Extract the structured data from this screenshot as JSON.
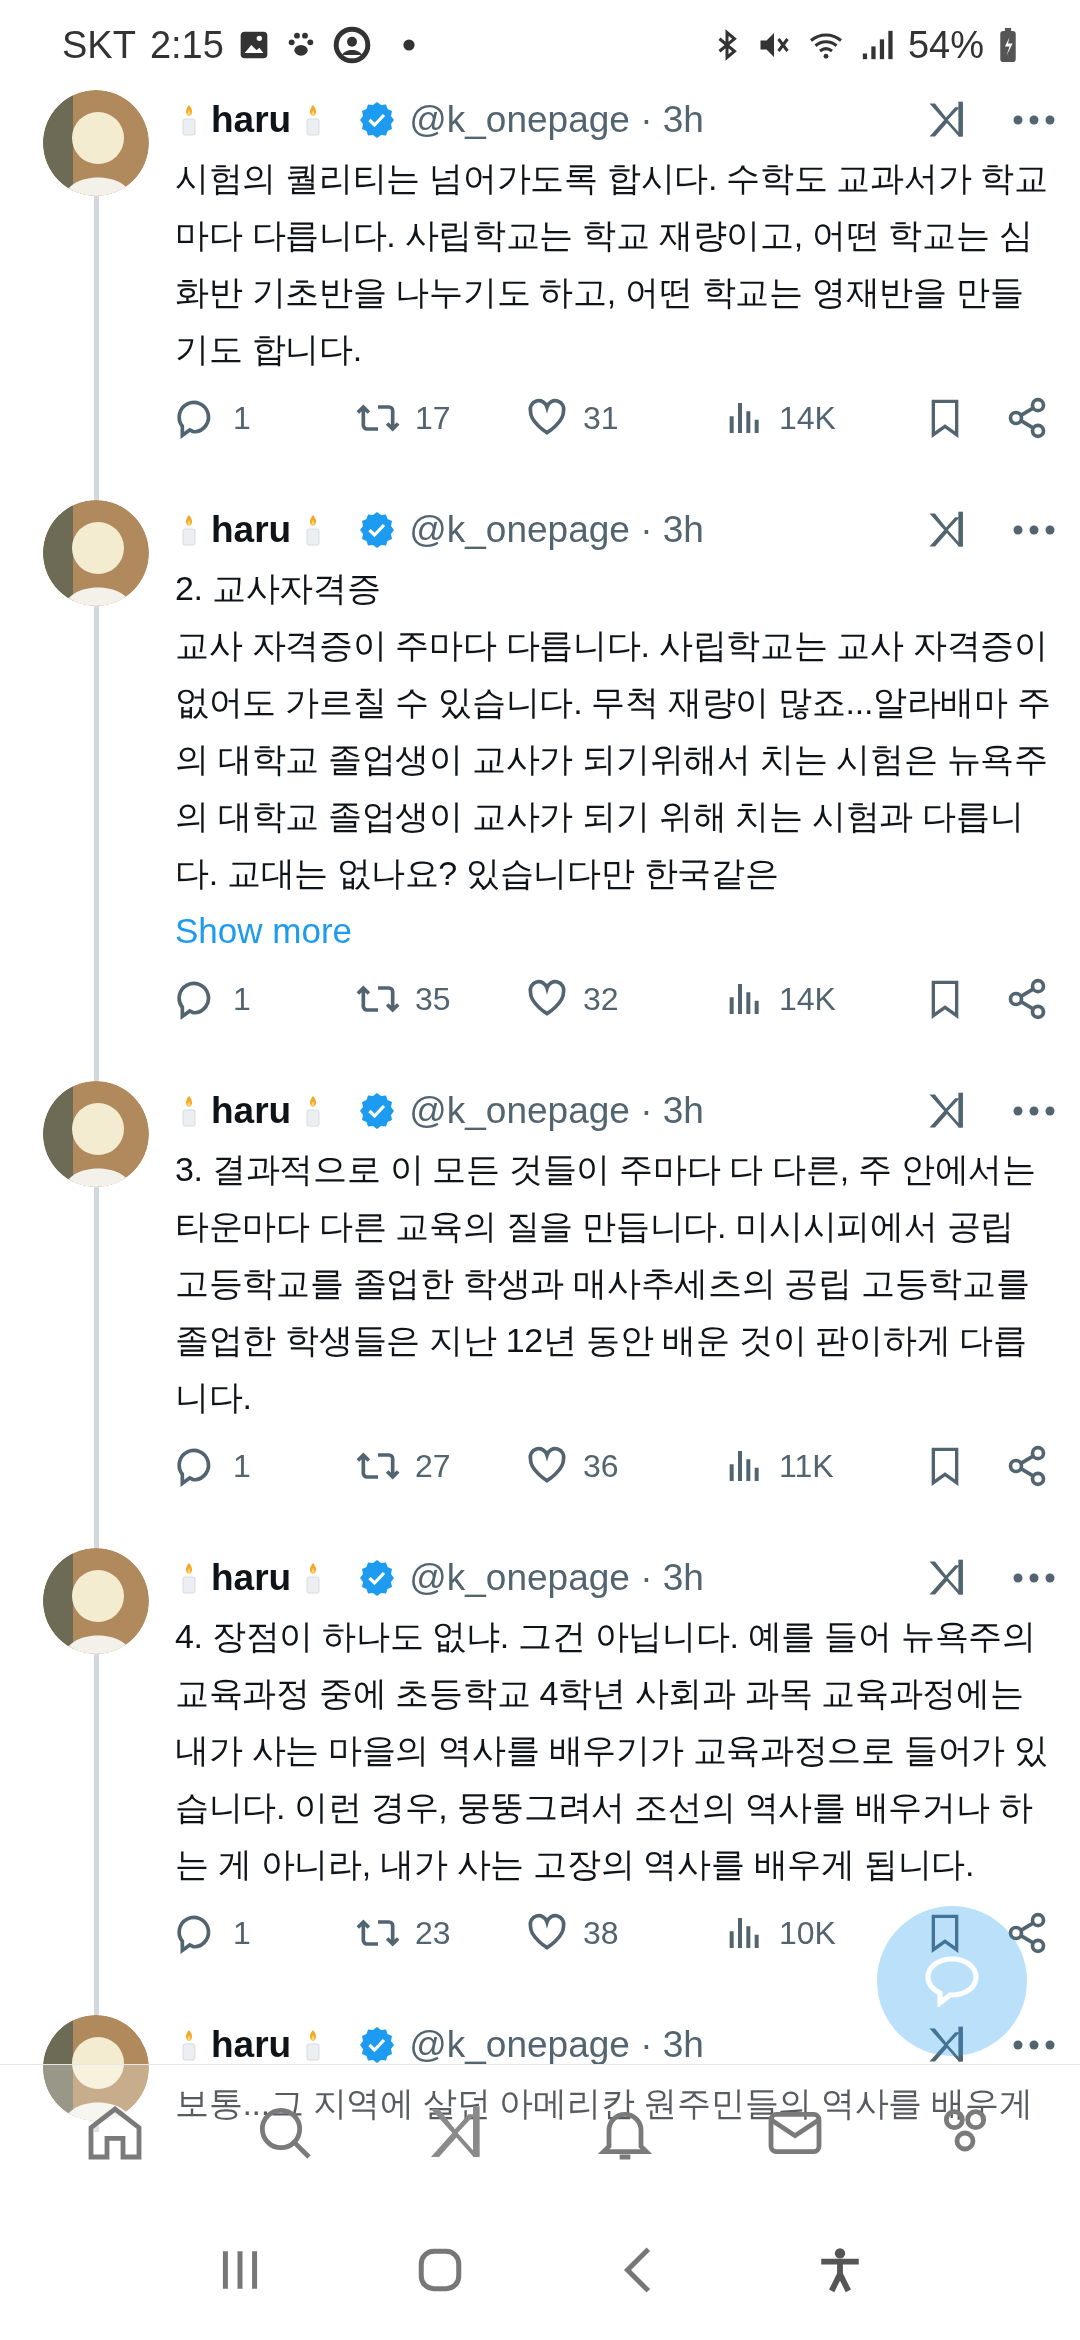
{
  "status_bar": {
    "carrier": "SKT",
    "time": "2:15",
    "battery": "54%"
  },
  "tweets": [
    {
      "name": "haru",
      "verified": true,
      "meta": "@k_onepage · 3h",
      "text": "시험의 퀄리티는 넘어가도록 합시다. 수학도 교과서가 학교마다 다릅니다. 사립학교는 학교 재량이고, 어떤 학교는 심화반 기초반을 나누기도 하고, 어떤 학교는 영재반을 만들기도 합니다.",
      "replies": "1",
      "reposts": "17",
      "likes": "31",
      "views": "14K"
    },
    {
      "name": "haru",
      "verified": true,
      "meta": "@k_onepage · 3h",
      "text": "2. 교사자격증\n교사 자격증이 주마다 다릅니다. 사립학교는 교사 자격증이 없어도 가르칠 수 있습니다. 무척 재량이 많죠...알라배마 주의 대학교 졸업생이 교사가 되기위해서 치는 시험은 뉴욕주의 대학교 졸업생이 교사가 되기 위해 치는 시험과 다릅니다. 교대는 없나요? 있습니다만 한국같은",
      "show_more": "Show more",
      "replies": "1",
      "reposts": "35",
      "likes": "32",
      "views": "14K"
    },
    {
      "name": "haru",
      "verified": true,
      "meta": "@k_onepage · 3h",
      "text": "3. 결과적으로 이 모든 것들이 주마다 다 다른, 주 안에서는 타운마다 다른 교육의 질을 만듭니다. 미시시피에서 공립 고등학교를 졸업한 학생과 매사추세츠의 공립 고등학교를 졸업한 학생들은 지난 12년 동안 배운 것이 판이하게 다릅니다.",
      "replies": "1",
      "reposts": "27",
      "likes": "36",
      "views": "11K"
    },
    {
      "name": "haru",
      "verified": true,
      "meta": "@k_onepage · 3h",
      "text": "4. 장점이 하나도 없냐. 그건 아닙니다. 예를 들어 뉴욕주의 교육과정 중에 초등학교 4학년 사회과 과목 교육과정에는 내가 사는 마을의 역사를 배우기가 교육과정으로 들어가 있습니다. 이런 경우, 뭉뚱그려서 조선의 역사를 배우거나 하는 게 아니라, 내가 사는 고장의 역사를 배우게 됩니다.",
      "replies": "1",
      "reposts": "23",
      "likes": "38",
      "views": "10K"
    },
    {
      "name": "haru",
      "verified": true,
      "meta": "@k_onepage · 3h",
      "text": "보통...그 지역에 살던 아메리칸 원주민들의 역사를 배우게"
    }
  ]
}
